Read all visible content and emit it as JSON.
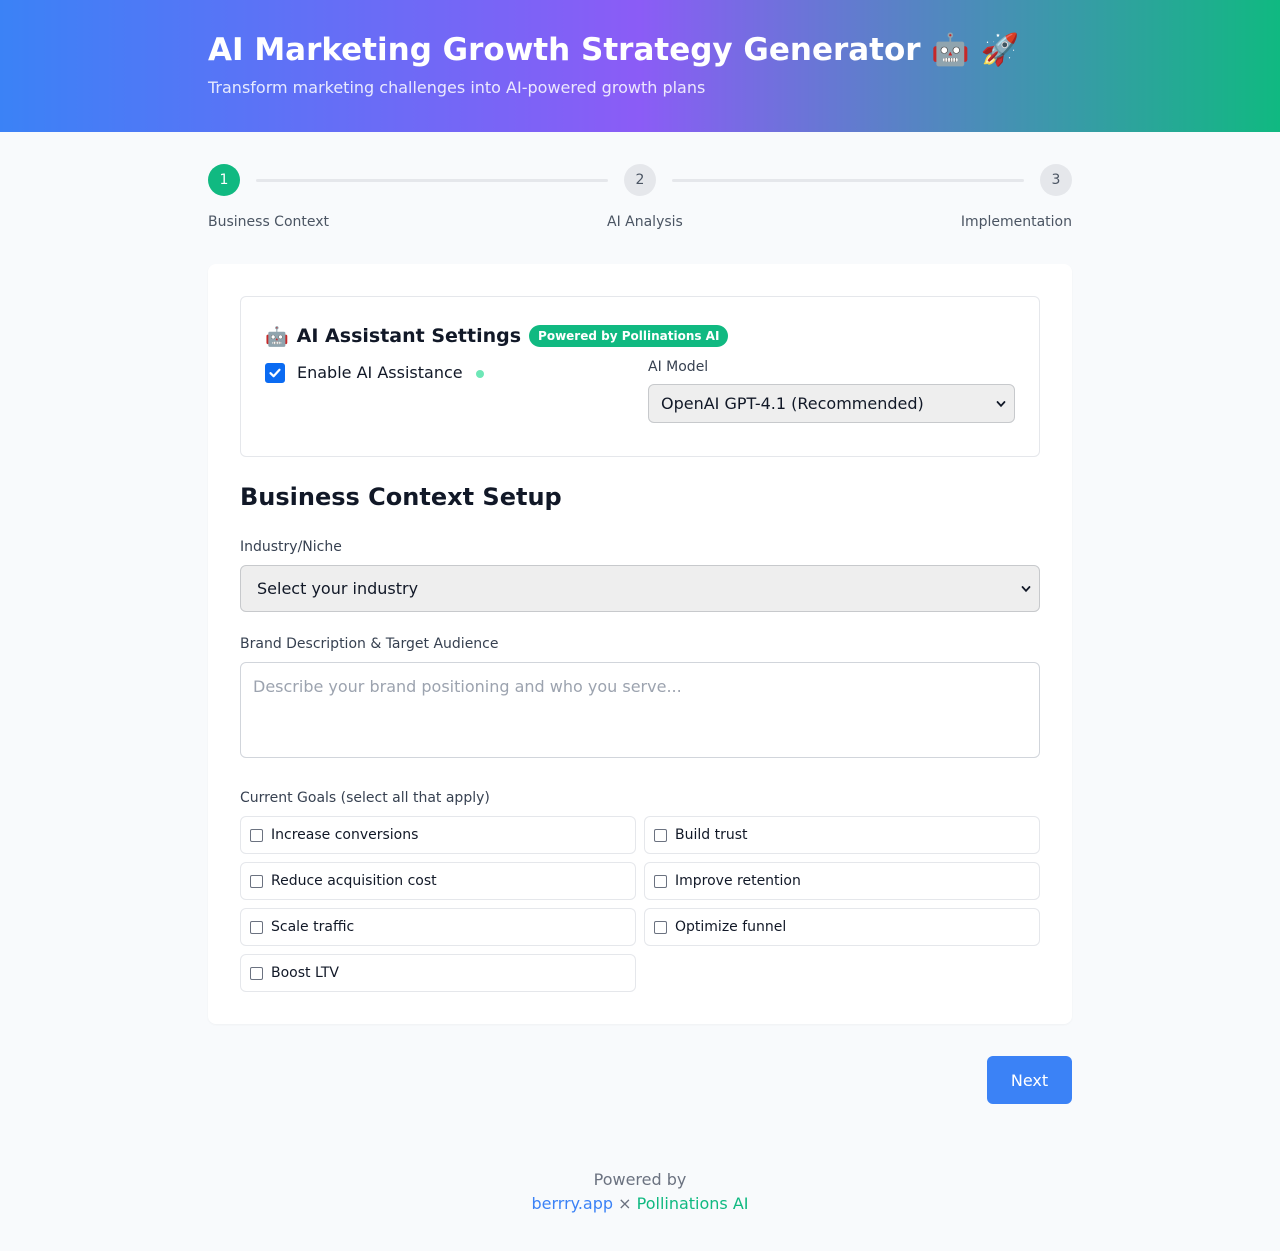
{
  "header": {
    "title": "AI Marketing Growth Strategy Generator 🤖 🚀",
    "subtitle": "Transform marketing challenges into AI-powered growth plans"
  },
  "stepper": {
    "active_step": 1,
    "steps": [
      {
        "number": "1",
        "label": "Business Context"
      },
      {
        "number": "2",
        "label": "AI Analysis"
      },
      {
        "number": "3",
        "label": "Implementation"
      }
    ]
  },
  "ai_settings": {
    "icon": "robot-icon",
    "emoji": "🤖",
    "title": "AI Assistant Settings",
    "badge": "Powered by Pollinations AI",
    "enable_label": "Enable AI Assistance",
    "enable_checked": true,
    "model_label": "AI Model",
    "model_selected": "OpenAI GPT-4.1 (Recommended)"
  },
  "form": {
    "section_title": "Business Context Setup",
    "industry_label": "Industry/Niche",
    "industry_selected": "Select your industry",
    "brand_label": "Brand Description & Target Audience",
    "brand_placeholder": "Describe your brand positioning and who you serve...",
    "goals_label": "Current Goals (select all that apply)",
    "goals": [
      {
        "label": "Increase conversions",
        "checked": false
      },
      {
        "label": "Build trust",
        "checked": false
      },
      {
        "label": "Reduce acquisition cost",
        "checked": false
      },
      {
        "label": "Improve retention",
        "checked": false
      },
      {
        "label": "Scale traffic",
        "checked": false
      },
      {
        "label": "Optimize funnel",
        "checked": false
      },
      {
        "label": "Boost LTV",
        "checked": false
      }
    ]
  },
  "actions": {
    "next_label": "Next"
  },
  "footer": {
    "powered_by": "Powered by",
    "link1": "berrry.app",
    "separator": "×",
    "link2": "Pollinations AI"
  },
  "colors": {
    "accent_blue": "#3b82f6",
    "accent_green": "#10b981",
    "accent_purple": "#8b5cf6"
  }
}
